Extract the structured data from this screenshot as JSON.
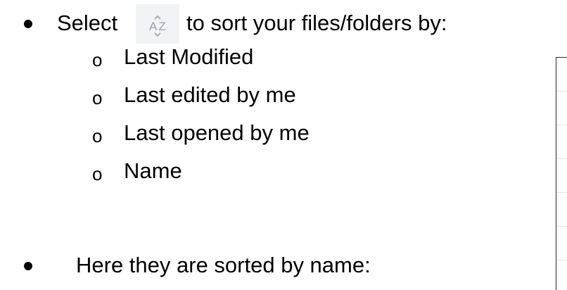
{
  "bullet1": {
    "before_icon": "Select",
    "after_icon": "to sort your files/folders by:",
    "icon": "sort-az-icon"
  },
  "sub_marker": "o",
  "sort_options": [
    "Last Modified",
    "Last edited by me",
    "Last opened by me",
    "Name"
  ],
  "bullet2": {
    "text": "Here they are sorted by name:"
  },
  "colors": {
    "text": "#000000",
    "icon_bg": "#f1f3f4",
    "icon_fg": "#9aa0a6",
    "frame_border": "#2b2b2b"
  }
}
